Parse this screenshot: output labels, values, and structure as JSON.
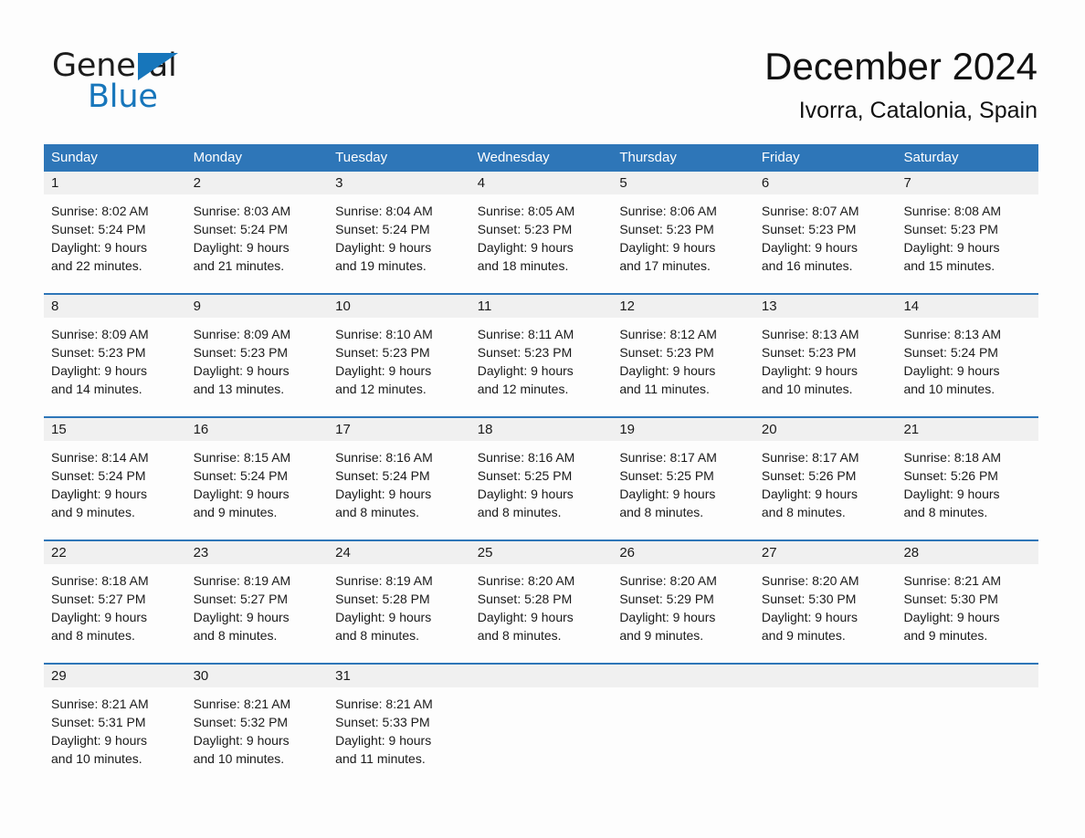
{
  "brand": {
    "name_part1": "General",
    "name_part2": "Blue",
    "triangle_icon": "triangle-logo-icon",
    "accent_color": "#1776bb"
  },
  "header": {
    "title": "December 2024",
    "location": "Ivorra, Catalonia, Spain"
  },
  "theme": {
    "header_blue": "#2e76b8",
    "row_rule_blue": "#2e76b8",
    "day_number_band": "#f0f0f0",
    "page_background": "#fdfdfd",
    "text_color": "#1a1a1a"
  },
  "calendar": {
    "weekdays": [
      "Sunday",
      "Monday",
      "Tuesday",
      "Wednesday",
      "Thursday",
      "Friday",
      "Saturday"
    ],
    "weeks": [
      {
        "days": [
          {
            "num": "1",
            "sunrise": "Sunrise: 8:02 AM",
            "sunset": "Sunset: 5:24 PM",
            "daylight1": "Daylight: 9 hours",
            "daylight2": "and 22 minutes."
          },
          {
            "num": "2",
            "sunrise": "Sunrise: 8:03 AM",
            "sunset": "Sunset: 5:24 PM",
            "daylight1": "Daylight: 9 hours",
            "daylight2": "and 21 minutes."
          },
          {
            "num": "3",
            "sunrise": "Sunrise: 8:04 AM",
            "sunset": "Sunset: 5:24 PM",
            "daylight1": "Daylight: 9 hours",
            "daylight2": "and 19 minutes."
          },
          {
            "num": "4",
            "sunrise": "Sunrise: 8:05 AM",
            "sunset": "Sunset: 5:23 PM",
            "daylight1": "Daylight: 9 hours",
            "daylight2": "and 18 minutes."
          },
          {
            "num": "5",
            "sunrise": "Sunrise: 8:06 AM",
            "sunset": "Sunset: 5:23 PM",
            "daylight1": "Daylight: 9 hours",
            "daylight2": "and 17 minutes."
          },
          {
            "num": "6",
            "sunrise": "Sunrise: 8:07 AM",
            "sunset": "Sunset: 5:23 PM",
            "daylight1": "Daylight: 9 hours",
            "daylight2": "and 16 minutes."
          },
          {
            "num": "7",
            "sunrise": "Sunrise: 8:08 AM",
            "sunset": "Sunset: 5:23 PM",
            "daylight1": "Daylight: 9 hours",
            "daylight2": "and 15 minutes."
          }
        ]
      },
      {
        "days": [
          {
            "num": "8",
            "sunrise": "Sunrise: 8:09 AM",
            "sunset": "Sunset: 5:23 PM",
            "daylight1": "Daylight: 9 hours",
            "daylight2": "and 14 minutes."
          },
          {
            "num": "9",
            "sunrise": "Sunrise: 8:09 AM",
            "sunset": "Sunset: 5:23 PM",
            "daylight1": "Daylight: 9 hours",
            "daylight2": "and 13 minutes."
          },
          {
            "num": "10",
            "sunrise": "Sunrise: 8:10 AM",
            "sunset": "Sunset: 5:23 PM",
            "daylight1": "Daylight: 9 hours",
            "daylight2": "and 12 minutes."
          },
          {
            "num": "11",
            "sunrise": "Sunrise: 8:11 AM",
            "sunset": "Sunset: 5:23 PM",
            "daylight1": "Daylight: 9 hours",
            "daylight2": "and 12 minutes."
          },
          {
            "num": "12",
            "sunrise": "Sunrise: 8:12 AM",
            "sunset": "Sunset: 5:23 PM",
            "daylight1": "Daylight: 9 hours",
            "daylight2": "and 11 minutes."
          },
          {
            "num": "13",
            "sunrise": "Sunrise: 8:13 AM",
            "sunset": "Sunset: 5:23 PM",
            "daylight1": "Daylight: 9 hours",
            "daylight2": "and 10 minutes."
          },
          {
            "num": "14",
            "sunrise": "Sunrise: 8:13 AM",
            "sunset": "Sunset: 5:24 PM",
            "daylight1": "Daylight: 9 hours",
            "daylight2": "and 10 minutes."
          }
        ]
      },
      {
        "days": [
          {
            "num": "15",
            "sunrise": "Sunrise: 8:14 AM",
            "sunset": "Sunset: 5:24 PM",
            "daylight1": "Daylight: 9 hours",
            "daylight2": "and 9 minutes."
          },
          {
            "num": "16",
            "sunrise": "Sunrise: 8:15 AM",
            "sunset": "Sunset: 5:24 PM",
            "daylight1": "Daylight: 9 hours",
            "daylight2": "and 9 minutes."
          },
          {
            "num": "17",
            "sunrise": "Sunrise: 8:16 AM",
            "sunset": "Sunset: 5:24 PM",
            "daylight1": "Daylight: 9 hours",
            "daylight2": "and 8 minutes."
          },
          {
            "num": "18",
            "sunrise": "Sunrise: 8:16 AM",
            "sunset": "Sunset: 5:25 PM",
            "daylight1": "Daylight: 9 hours",
            "daylight2": "and 8 minutes."
          },
          {
            "num": "19",
            "sunrise": "Sunrise: 8:17 AM",
            "sunset": "Sunset: 5:25 PM",
            "daylight1": "Daylight: 9 hours",
            "daylight2": "and 8 minutes."
          },
          {
            "num": "20",
            "sunrise": "Sunrise: 8:17 AM",
            "sunset": "Sunset: 5:26 PM",
            "daylight1": "Daylight: 9 hours",
            "daylight2": "and 8 minutes."
          },
          {
            "num": "21",
            "sunrise": "Sunrise: 8:18 AM",
            "sunset": "Sunset: 5:26 PM",
            "daylight1": "Daylight: 9 hours",
            "daylight2": "and 8 minutes."
          }
        ]
      },
      {
        "days": [
          {
            "num": "22",
            "sunrise": "Sunrise: 8:18 AM",
            "sunset": "Sunset: 5:27 PM",
            "daylight1": "Daylight: 9 hours",
            "daylight2": "and 8 minutes."
          },
          {
            "num": "23",
            "sunrise": "Sunrise: 8:19 AM",
            "sunset": "Sunset: 5:27 PM",
            "daylight1": "Daylight: 9 hours",
            "daylight2": "and 8 minutes."
          },
          {
            "num": "24",
            "sunrise": "Sunrise: 8:19 AM",
            "sunset": "Sunset: 5:28 PM",
            "daylight1": "Daylight: 9 hours",
            "daylight2": "and 8 minutes."
          },
          {
            "num": "25",
            "sunrise": "Sunrise: 8:20 AM",
            "sunset": "Sunset: 5:28 PM",
            "daylight1": "Daylight: 9 hours",
            "daylight2": "and 8 minutes."
          },
          {
            "num": "26",
            "sunrise": "Sunrise: 8:20 AM",
            "sunset": "Sunset: 5:29 PM",
            "daylight1": "Daylight: 9 hours",
            "daylight2": "and 9 minutes."
          },
          {
            "num": "27",
            "sunrise": "Sunrise: 8:20 AM",
            "sunset": "Sunset: 5:30 PM",
            "daylight1": "Daylight: 9 hours",
            "daylight2": "and 9 minutes."
          },
          {
            "num": "28",
            "sunrise": "Sunrise: 8:21 AM",
            "sunset": "Sunset: 5:30 PM",
            "daylight1": "Daylight: 9 hours",
            "daylight2": "and 9 minutes."
          }
        ]
      },
      {
        "days": [
          {
            "num": "29",
            "sunrise": "Sunrise: 8:21 AM",
            "sunset": "Sunset: 5:31 PM",
            "daylight1": "Daylight: 9 hours",
            "daylight2": "and 10 minutes."
          },
          {
            "num": "30",
            "sunrise": "Sunrise: 8:21 AM",
            "sunset": "Sunset: 5:32 PM",
            "daylight1": "Daylight: 9 hours",
            "daylight2": "and 10 minutes."
          },
          {
            "num": "31",
            "sunrise": "Sunrise: 8:21 AM",
            "sunset": "Sunset: 5:33 PM",
            "daylight1": "Daylight: 9 hours",
            "daylight2": "and 11 minutes."
          },
          {
            "num": "",
            "sunrise": "",
            "sunset": "",
            "daylight1": "",
            "daylight2": ""
          },
          {
            "num": "",
            "sunrise": "",
            "sunset": "",
            "daylight1": "",
            "daylight2": ""
          },
          {
            "num": "",
            "sunrise": "",
            "sunset": "",
            "daylight1": "",
            "daylight2": ""
          },
          {
            "num": "",
            "sunrise": "",
            "sunset": "",
            "daylight1": "",
            "daylight2": ""
          }
        ]
      }
    ]
  }
}
